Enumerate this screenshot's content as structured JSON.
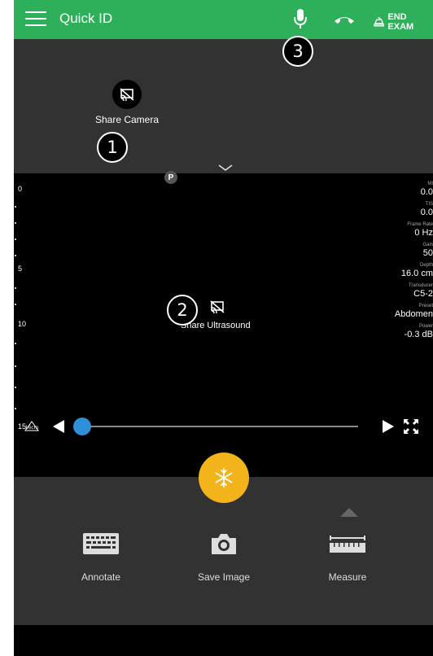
{
  "header": {
    "title": "Quick ID",
    "end_exam_label": "END EXAM",
    "bg_color": "#2eb05a"
  },
  "camera": {
    "share_label": "Share Camera"
  },
  "markers": [
    "1",
    "2",
    "3"
  ],
  "ultrasound": {
    "probe_badge": "P",
    "depth_ticks": [
      "0",
      "5",
      "10",
      "15"
    ],
    "depth_unit_label": "16cm",
    "share_label": "Share Ultrasound",
    "params": [
      {
        "label": "MI",
        "value": "0.0"
      },
      {
        "label": "TIS",
        "value": "0.0"
      },
      {
        "label": "Frame Rate",
        "value": "0 Hz"
      },
      {
        "label": "Gain",
        "value": "50"
      },
      {
        "label": "Depth",
        "value": "16.0 cm"
      },
      {
        "label": "Transducer",
        "value": "C5-2"
      },
      {
        "label": "Preset",
        "value": "Abdomen"
      },
      {
        "label": "Power",
        "value": "-0.3 dB"
      }
    ],
    "cine_position": 0.0
  },
  "controls": {
    "annotate_label": "Annotate",
    "save_image_label": "Save Image",
    "measure_label": "Measure"
  },
  "icons": {
    "menu": "hamburger-menu-icon",
    "mic": "microphone-icon",
    "phone": "hang-up-phone-icon",
    "end_exam": "end-exam-icon",
    "freeze": "snowflake-icon"
  },
  "colors": {
    "accent_green": "#2eb05a",
    "freeze_yellow": "#f3b41b",
    "slider_blue": "#2f8fd8"
  }
}
